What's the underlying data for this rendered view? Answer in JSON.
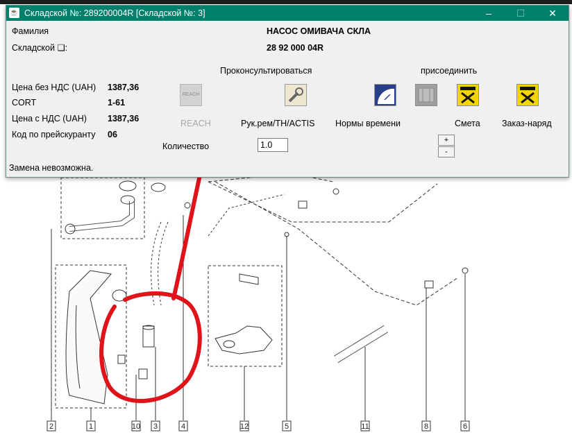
{
  "window": {
    "title": "Складской №: 289200004R [Складской №: 3]",
    "app_icon": "java-icon",
    "controls": {
      "minimize": "–",
      "maximize": "☐",
      "close": "✕"
    }
  },
  "part": {
    "name_label": "Фамилия",
    "name_value": "НАСОС ОМИВАЧА СКЛА",
    "stock_label": "Складской ❏:",
    "stock_value": "28 92 000 04R"
  },
  "prices": [
    {
      "label": "Цена без НДС (UAH)",
      "value": "1387,36"
    },
    {
      "label": "CORT",
      "value": "1-61"
    },
    {
      "label": "Цена с НДС (UAH)",
      "value": "1387,36"
    },
    {
      "label": "Код по прейскуранту",
      "value": "06"
    }
  ],
  "sections": {
    "consult": "Проконсультироваться",
    "attach": "присоединить"
  },
  "actions": {
    "reach": {
      "label": "REACH",
      "icon_text": "REACH",
      "enabled": false
    },
    "repair": {
      "label": "Рук.рем/TH/ACTIS"
    },
    "time_norms": {
      "label": "Нормы времени"
    },
    "estimate": {
      "label": "Смета"
    },
    "work_order": {
      "label": "Заказ-наряд"
    }
  },
  "quantity": {
    "label": "Количество",
    "value": "1.0",
    "plus": "+",
    "minus": "-"
  },
  "status": "Замена невозможна.",
  "diagram": {
    "callouts": [
      "2",
      "1",
      "10",
      "3",
      "4",
      "12",
      "5",
      "11",
      "8",
      "6"
    ],
    "annotation_color": "#e0131b"
  }
}
